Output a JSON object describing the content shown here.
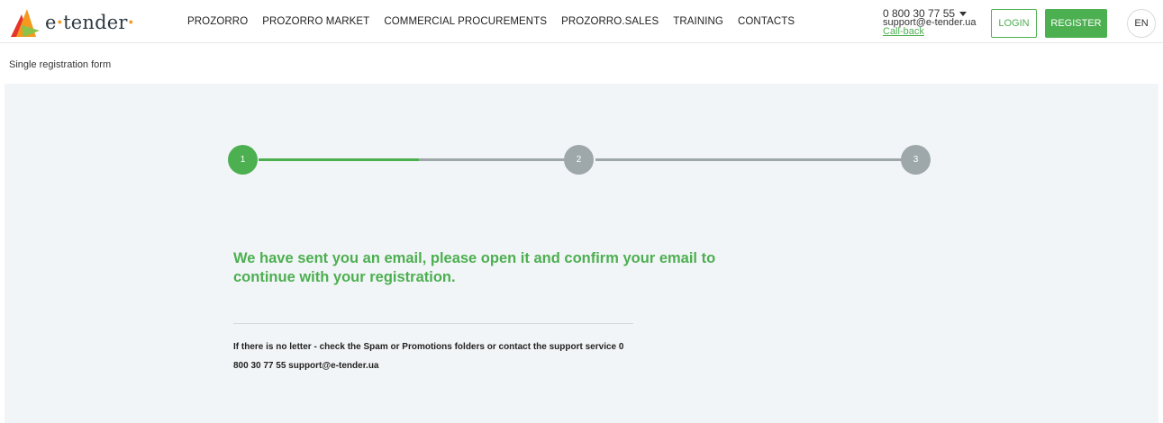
{
  "header": {
    "logo_text_a": "e",
    "logo_text_dot": "·",
    "logo_text_b": "tender",
    "logo_text_end": "·",
    "nav": [
      {
        "label": "PROZORRO"
      },
      {
        "label": "PROZORRO MARKET"
      },
      {
        "label": "COMMERCIAL PROCUREMENTS"
      },
      {
        "label": "PROZORRO.SALES"
      },
      {
        "label": "TRAINING"
      },
      {
        "label": "CONTACTS"
      }
    ],
    "contacts": {
      "phone": "0 800 30 77 55",
      "email": "support@e-tender.ua",
      "callback": "Call-back"
    },
    "login_label": "LOGIN",
    "register_label": "REGISTER",
    "language": "EN"
  },
  "breadcrumb": {
    "title": "Single registration form"
  },
  "stepper": {
    "current_step": 1,
    "steps": [
      {
        "label": "1"
      },
      {
        "label": "2"
      },
      {
        "label": "3"
      }
    ],
    "progress_fraction": 0.25
  },
  "content": {
    "message": "We have sent you an email, please open it and confirm your email to continue with your registration.",
    "note": "If there is no letter - check the Spam or Promotions folders or contact the support service 0 800 30 77 55 support@e-tender.ua"
  },
  "colors": {
    "accent": "#4caf50",
    "step_inactive": "#9ea7a9",
    "background": "#f2f5f7",
    "logo_orange": "#f39a1f",
    "logo_red": "#e5352b"
  },
  "icons": [
    "logo-icon",
    "chevron-down-icon"
  ]
}
